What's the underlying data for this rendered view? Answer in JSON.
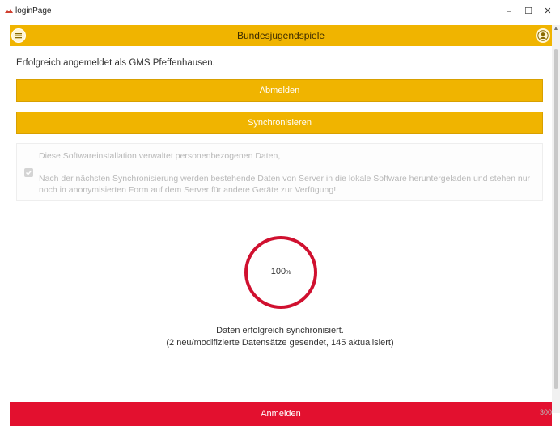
{
  "window": {
    "title": "loginPage",
    "controls": {
      "minimize": "–",
      "maximize": "☐",
      "close": "✕"
    }
  },
  "appbar": {
    "title": "Bundesjugendspiele",
    "menu_icon": "menu-icon",
    "user_icon": "user-icon",
    "color": "#f0b400"
  },
  "status": {
    "text": "Erfolgreich angemeldet als GMS Pfeffenhausen."
  },
  "buttons": {
    "logout": "Abmelden",
    "sync": "Synchronisieren",
    "login": "Anmelden",
    "login_color": "#e3102f"
  },
  "consent": {
    "line1": "Diese Softwareinstallation verwaltet personenbezogenen Daten,",
    "line2": "Nach der nächsten Synchronisierung werden bestehende Daten von Server in die lokale Software heruntergeladen und stehen nur noch in anonymisierten Form auf dem Server für andere Geräte zur Verfügung!",
    "checked": true,
    "disabled": true
  },
  "progress": {
    "value": 100,
    "value_text": "100",
    "unit": "%",
    "color": "#d0102f"
  },
  "result": {
    "line1": "Daten erfolgreich synchronisiert.",
    "line2": "(2 neu/modifizierte Datensätze gesendet, 145 aktualisiert)"
  },
  "corner": {
    "text": "300"
  }
}
